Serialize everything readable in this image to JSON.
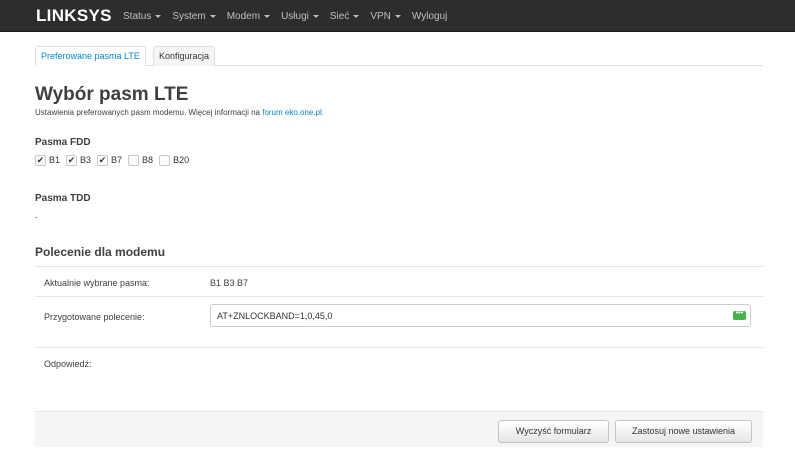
{
  "navbar": {
    "brand": "LINKSYS",
    "items": [
      {
        "label": "Status",
        "dropdown": true
      },
      {
        "label": "System",
        "dropdown": true
      },
      {
        "label": "Modem",
        "dropdown": true
      },
      {
        "label": "Usługi",
        "dropdown": true
      },
      {
        "label": "Sieć",
        "dropdown": true
      },
      {
        "label": "VPN",
        "dropdown": true
      },
      {
        "label": "Wyloguj",
        "dropdown": false
      }
    ]
  },
  "tabs": [
    {
      "label": "Preferowane pasma LTE",
      "active": true
    },
    {
      "label": "Konfiguracja",
      "active": false
    }
  ],
  "page": {
    "title": "Wybór pasm LTE",
    "description": "Ustawienia preferowanych pasm modemu. Więcej informacji na",
    "link_text": "forum eko.one.pl."
  },
  "fdd": {
    "label": "Pasma FDD",
    "bands": [
      {
        "label": "B1",
        "checked": true
      },
      {
        "label": "B3",
        "checked": true
      },
      {
        "label": "B7",
        "checked": true
      },
      {
        "label": "B8",
        "checked": false
      },
      {
        "label": "B20",
        "checked": false
      }
    ]
  },
  "tdd": {
    "label": "Pasma TDD",
    "value": "-"
  },
  "modem": {
    "title": "Polecenie dla modemu",
    "current_label": "Aktualnie wybrane pasma:",
    "current_value": "B1 B3 B7",
    "command_label": "Przygotowane polecenie:",
    "command_value": "AT+ZNLOCKBAND=1,0,45,0",
    "response_label": "Odpowiedź:",
    "response_value": ""
  },
  "buttons": {
    "clear": "Wyczyść formularz",
    "apply": "Zastosuj nowe ustawienia"
  },
  "colors": {
    "navbar_bg": "#2d2d2d",
    "link": "#0088cc",
    "badge": "#44b549"
  }
}
